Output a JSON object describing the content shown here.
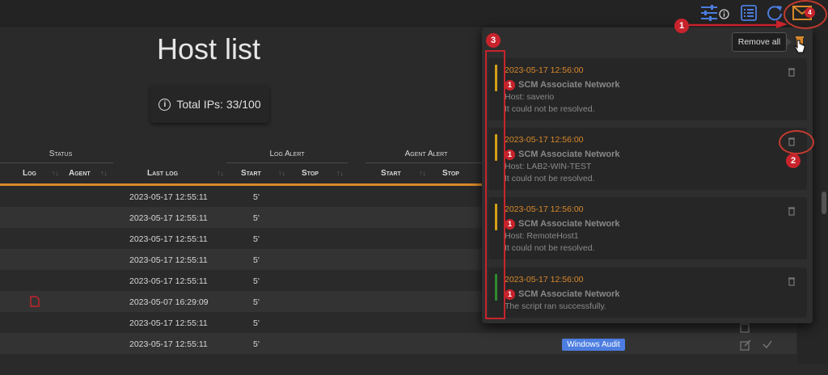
{
  "page": {
    "title": "Host list",
    "total_ips": "Total IPs: 33/100"
  },
  "table": {
    "groups": {
      "status": "Status",
      "log_alert": "Log Alert",
      "agent_alert": "Agent Alert"
    },
    "columns": {
      "log": "Log",
      "agent": "Agent",
      "last_log": "Last log",
      "log_start": "Start",
      "log_stop": "Stop",
      "agent_start": "Start",
      "agent_stop": "Stop"
    },
    "rows": [
      {
        "last_log": "2023-05-17 12:55:11",
        "log_start": "5'"
      },
      {
        "last_log": "2023-05-17 12:55:11",
        "log_start": "5'"
      },
      {
        "last_log": "2023-05-17 12:55:11",
        "log_start": "5'"
      },
      {
        "last_log": "2023-05-17 12:55:11",
        "log_start": "5'"
      },
      {
        "last_log": "2023-05-17 12:55:11",
        "log_start": "5'"
      },
      {
        "last_log": "2023-05-07 16:29:09",
        "log_start": "5'"
      },
      {
        "last_log": "2023-05-17 12:55:11",
        "log_start": "5'"
      },
      {
        "last_log": "2023-05-17 12:55:11",
        "log_start": "5'"
      }
    ],
    "badge": "Windows Audit"
  },
  "toolbar": {
    "mail_count": "4",
    "remove_all_tooltip": "Remove all"
  },
  "notifications": [
    {
      "date": "2023-05-17 12:56:00",
      "badge": "1",
      "title": "SCM Associate Network",
      "line1": "Host: saverio",
      "line2": "It could not be resolved.",
      "level_color": "#d4a017"
    },
    {
      "date": "2023-05-17 12:56:00",
      "badge": "1",
      "title": "SCM Associate Network",
      "line1": "Host: LAB2-WIN-TEST",
      "line2": "It could not be resolved.",
      "level_color": "#d4a017"
    },
    {
      "date": "2023-05-17 12:56:00",
      "badge": "1",
      "title": "SCM Associate Network",
      "line1": "Host: RemoteHost1",
      "line2": "It could not be resolved.",
      "level_color": "#d4a017"
    },
    {
      "date": "2023-05-17 12:56:00",
      "badge": "1",
      "title": "SCM Associate Network",
      "line1": "The script ran successfully.",
      "line2": "",
      "level_color": "#2e8b2e"
    }
  ],
  "annotations": {
    "step1": "1",
    "step2": "2",
    "step3": "3"
  },
  "colors": {
    "accent_orange": "#d9882a",
    "annotation_red": "#c8232c",
    "toolbar_blue": "#4c7de0"
  }
}
